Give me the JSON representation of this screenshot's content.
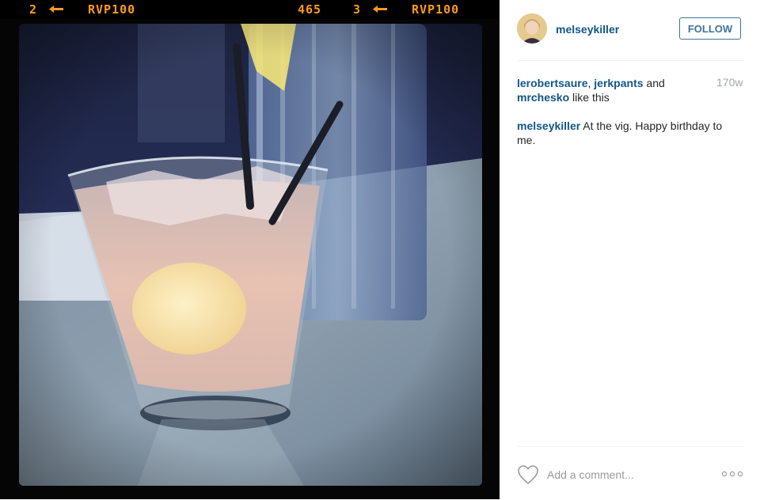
{
  "film_strip": {
    "frame_left": "2",
    "label_left": "RVP100",
    "counter": "465",
    "frame_right": "3",
    "label_right": "RVP100"
  },
  "photo": {
    "alt": "Cocktail glass with straw on a table next to a water glass"
  },
  "post": {
    "username": "melseykiller",
    "follow_label": "FOLLOW",
    "likes": {
      "user1": "lerobertsaure",
      "separator": ", ",
      "user2": "jerkpants",
      "and_text": " and",
      "user3": "mrchesko",
      "suffix": " like this"
    },
    "timestamp": "170w",
    "caption": {
      "author": "melseykiller",
      "text": " At the vig. Happy birthday to me."
    },
    "comment_placeholder": "Add a comment...",
    "icons": {
      "like": "heart-icon",
      "more": "more-options-icon"
    }
  },
  "colors": {
    "link": "#125688",
    "follow_border": "#3f729b",
    "film_text": "#ff9a1f",
    "timestamp": "#a5a7aa"
  }
}
